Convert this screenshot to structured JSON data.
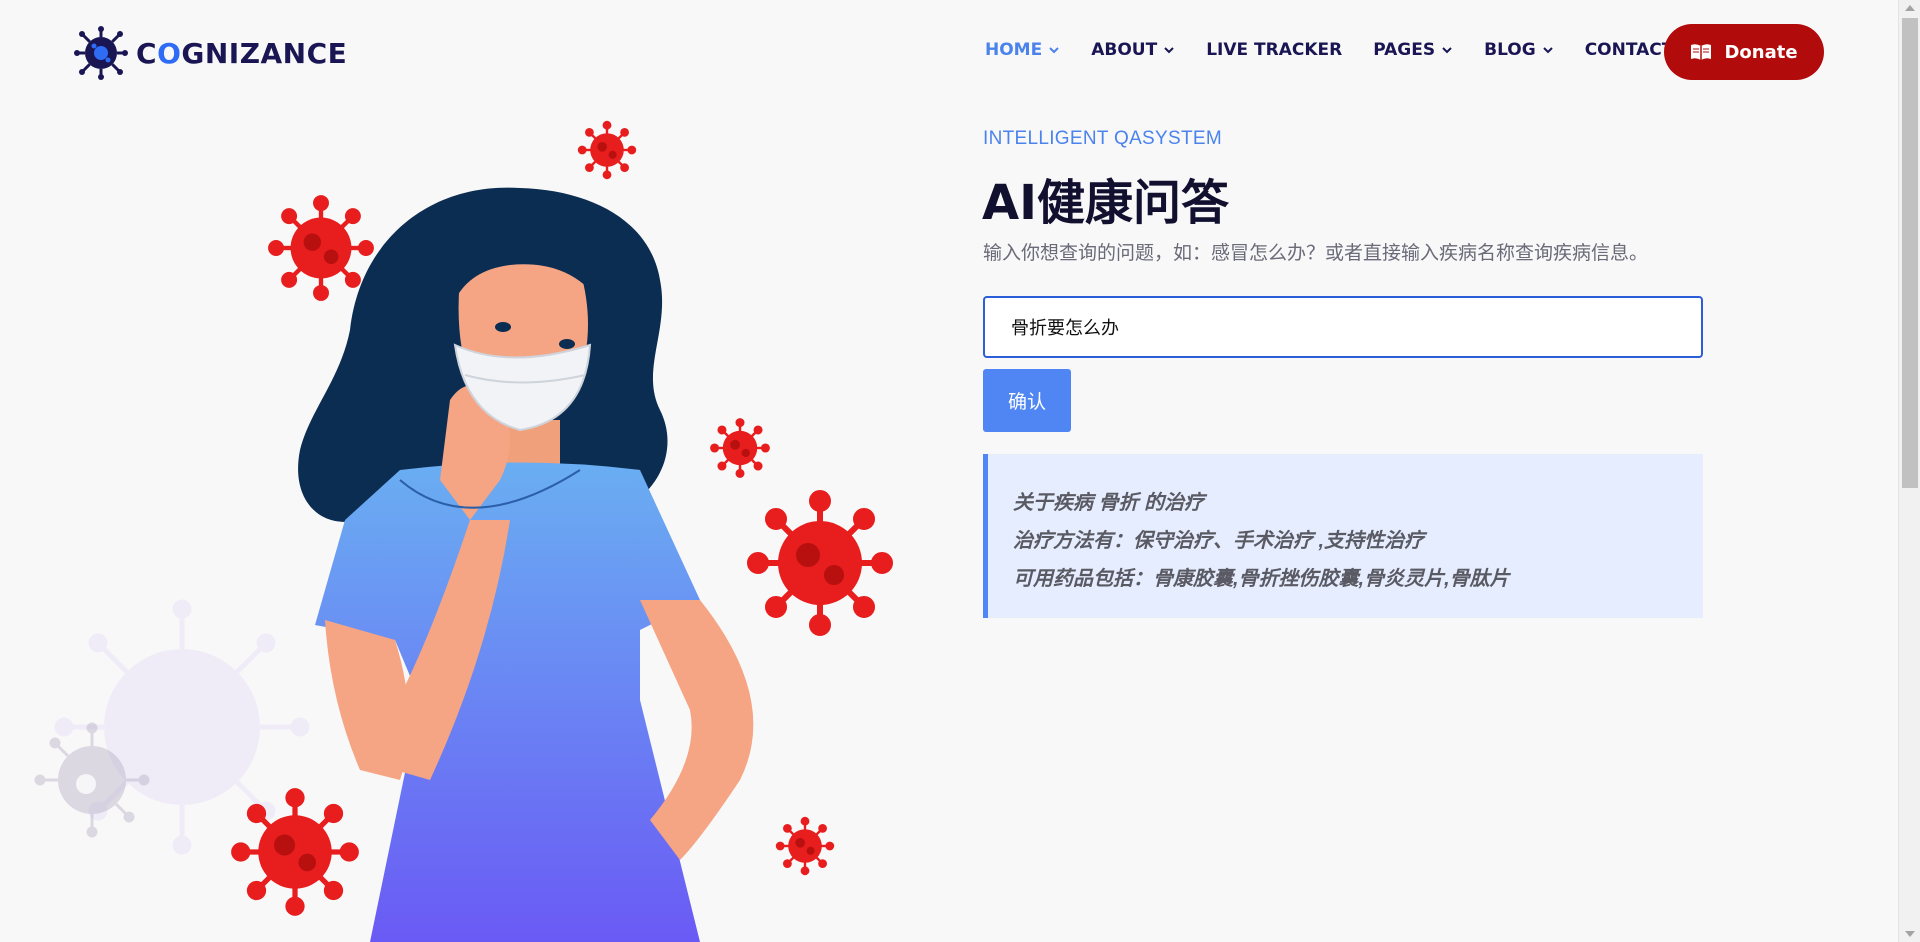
{
  "brand": {
    "name_prefix": "C",
    "name_o": "O",
    "name_rest": "GNIZANCE"
  },
  "nav": {
    "items": [
      {
        "label": "HOME",
        "dropdown": true,
        "active": true
      },
      {
        "label": "ABOUT",
        "dropdown": true,
        "active": false
      },
      {
        "label": "LIVE TRACKER",
        "dropdown": false,
        "active": false
      },
      {
        "label": "PAGES",
        "dropdown": true,
        "active": false
      },
      {
        "label": "BLOG",
        "dropdown": true,
        "active": false
      },
      {
        "label": "CONTACT",
        "dropdown": false,
        "active": false
      }
    ],
    "donate_label": "Donate",
    "donate_icon": "book-open-icon"
  },
  "hero": {
    "subtitle": "INTELLIGENT QASYSTEM",
    "title": "AI健康问答",
    "description": "输入你想查询的问题，如：感冒怎么办？或者直接输入疾病名称查询疾病信息。"
  },
  "search": {
    "value": "骨折要怎么办",
    "button_label": "确认"
  },
  "answer": {
    "line1": "关于疾病 骨折 的治疗",
    "line2": "治疗方法有：保守治疗、手术治疗 ,支持性治疗",
    "line3": "可用药品包括：骨康胶囊,骨折挫伤胶囊,骨炎灵片,骨肽片"
  },
  "colors": {
    "accent": "#4b83ec",
    "navy": "#1a1654",
    "donate": "#b20b0b",
    "virus": "#e81d1d"
  }
}
